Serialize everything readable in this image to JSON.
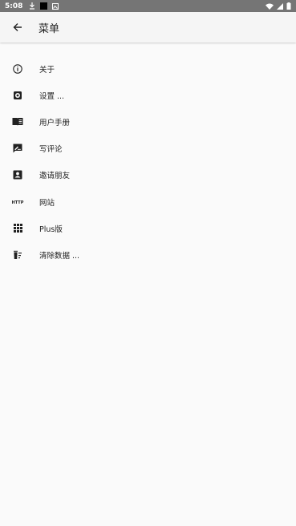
{
  "status_bar": {
    "time": "5:08"
  },
  "app_bar": {
    "title": "菜单"
  },
  "menu": {
    "items": [
      {
        "label": "关于",
        "icon": "info-icon"
      },
      {
        "label": "设置 ...",
        "icon": "settings-icon"
      },
      {
        "label": "用户手册",
        "icon": "book-icon"
      },
      {
        "label": "写评论",
        "icon": "rate-review-icon"
      },
      {
        "label": "邀请朋友",
        "icon": "contact-icon"
      },
      {
        "label": "网站",
        "icon": "http-icon",
        "icon_text": "HTTP"
      },
      {
        "label": "Plus版",
        "icon": "grid-icon"
      },
      {
        "label": "清除数据 ...",
        "icon": "delete-sweep-icon"
      }
    ]
  },
  "colors": {
    "status_bar": "#757575",
    "app_bar": "#f5f5f5",
    "background": "#fafafa",
    "icon": "#212121"
  }
}
